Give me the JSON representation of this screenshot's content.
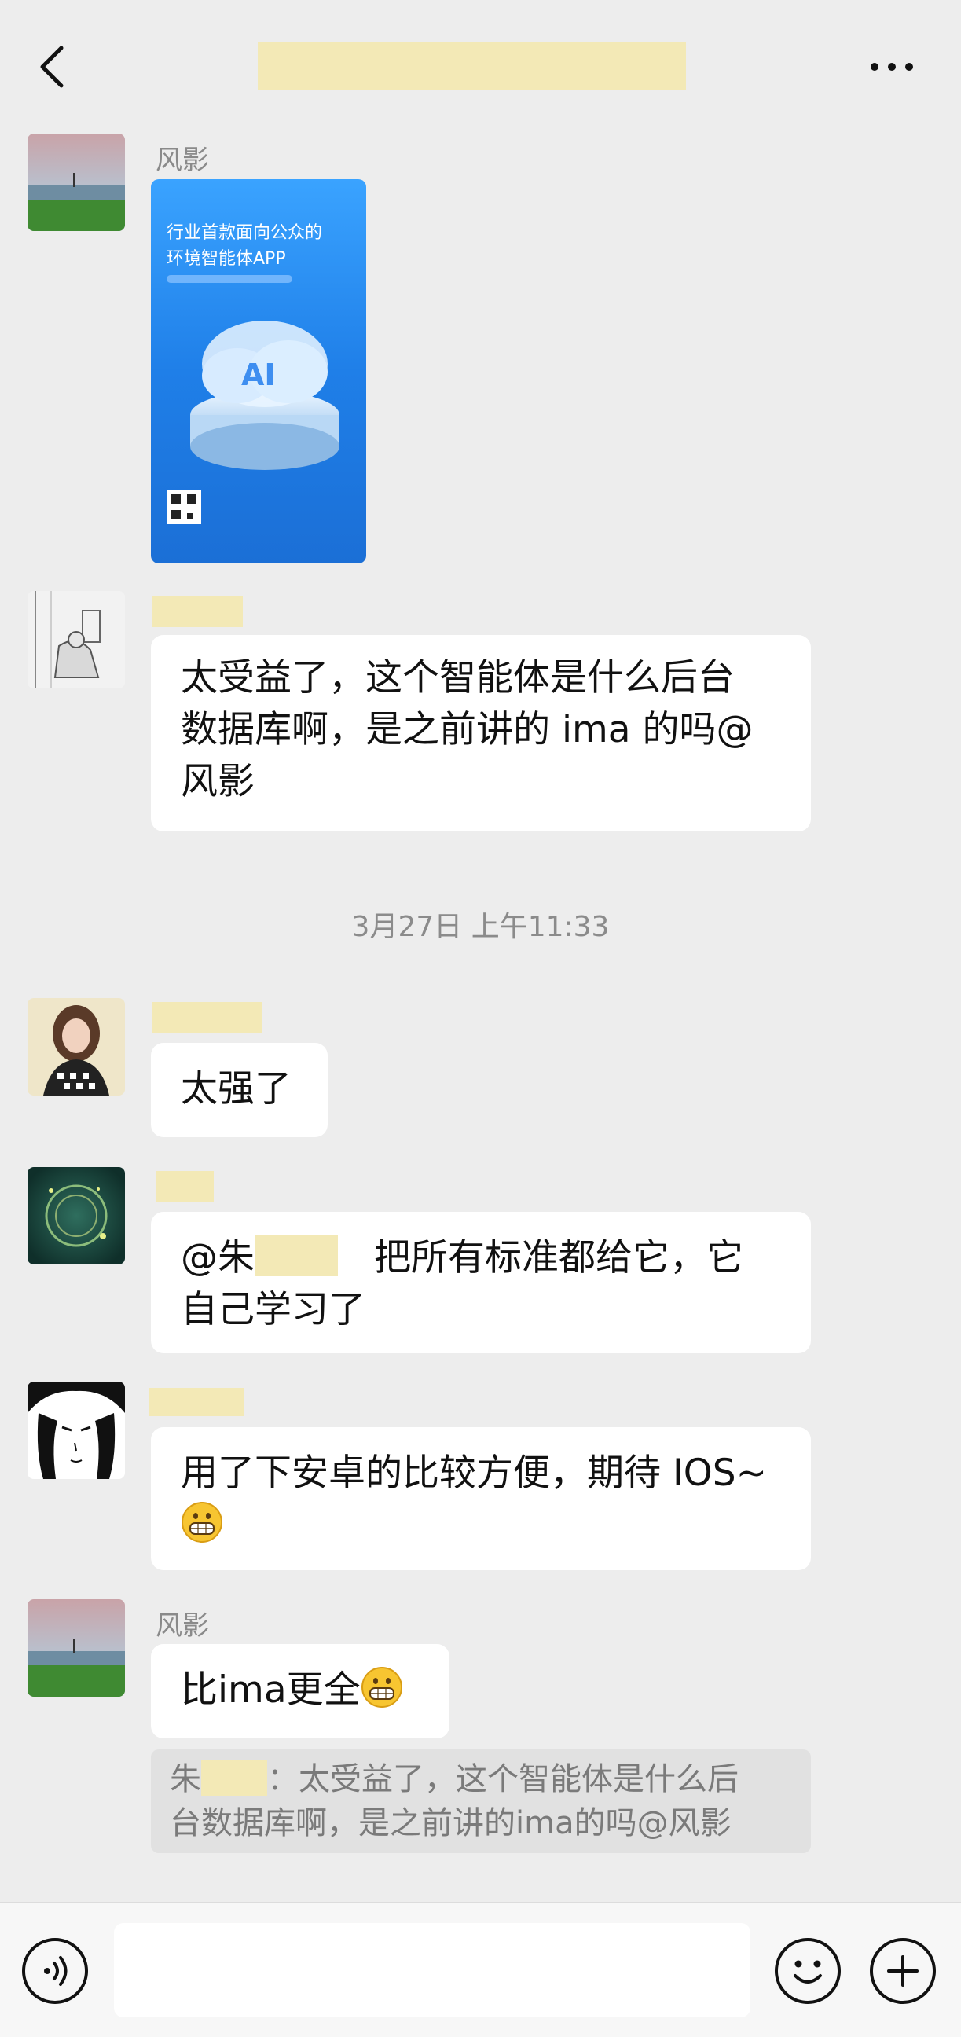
{
  "header": {
    "back_icon": "chevron-left-icon",
    "more_icon": "more-icon"
  },
  "messages": [
    {
      "sender": "风影",
      "type": "image",
      "poster_text": [
        "行业首款面向公众的",
        "环境智能体APP",
        "AI"
      ]
    },
    {
      "sender": "",
      "type": "text",
      "lines": [
        "太受益了，这个智能体是什么后台",
        "数据库啊，是之前讲的 ima 的吗@",
        "风影"
      ]
    },
    {
      "type": "timestamp",
      "text": "3月27日 上午11:33"
    },
    {
      "sender": "",
      "type": "text",
      "lines": [
        "太强了"
      ]
    },
    {
      "sender": "",
      "type": "text",
      "mention_prefix": "@朱",
      "line1_rest": "把所有标准都给它，它",
      "line2": "自己学习了"
    },
    {
      "sender": "",
      "type": "text",
      "line1": "用了下安卓的比较方便，期待 IOS~",
      "emoji": "grin-emoji"
    },
    {
      "sender": "风影",
      "type": "text",
      "text": "比ima更全",
      "emoji": "grin-emoji",
      "quote": {
        "prefix": "朱",
        "sep": "：",
        "line1": "太受益了，这个智能体是什么后",
        "line2": "台数据库啊，是之前讲的ima的吗@风影"
      }
    }
  ],
  "bottom": {
    "voice_icon": "voice-icon",
    "emoji_icon": "emoji-icon",
    "plus_icon": "plus-icon"
  }
}
